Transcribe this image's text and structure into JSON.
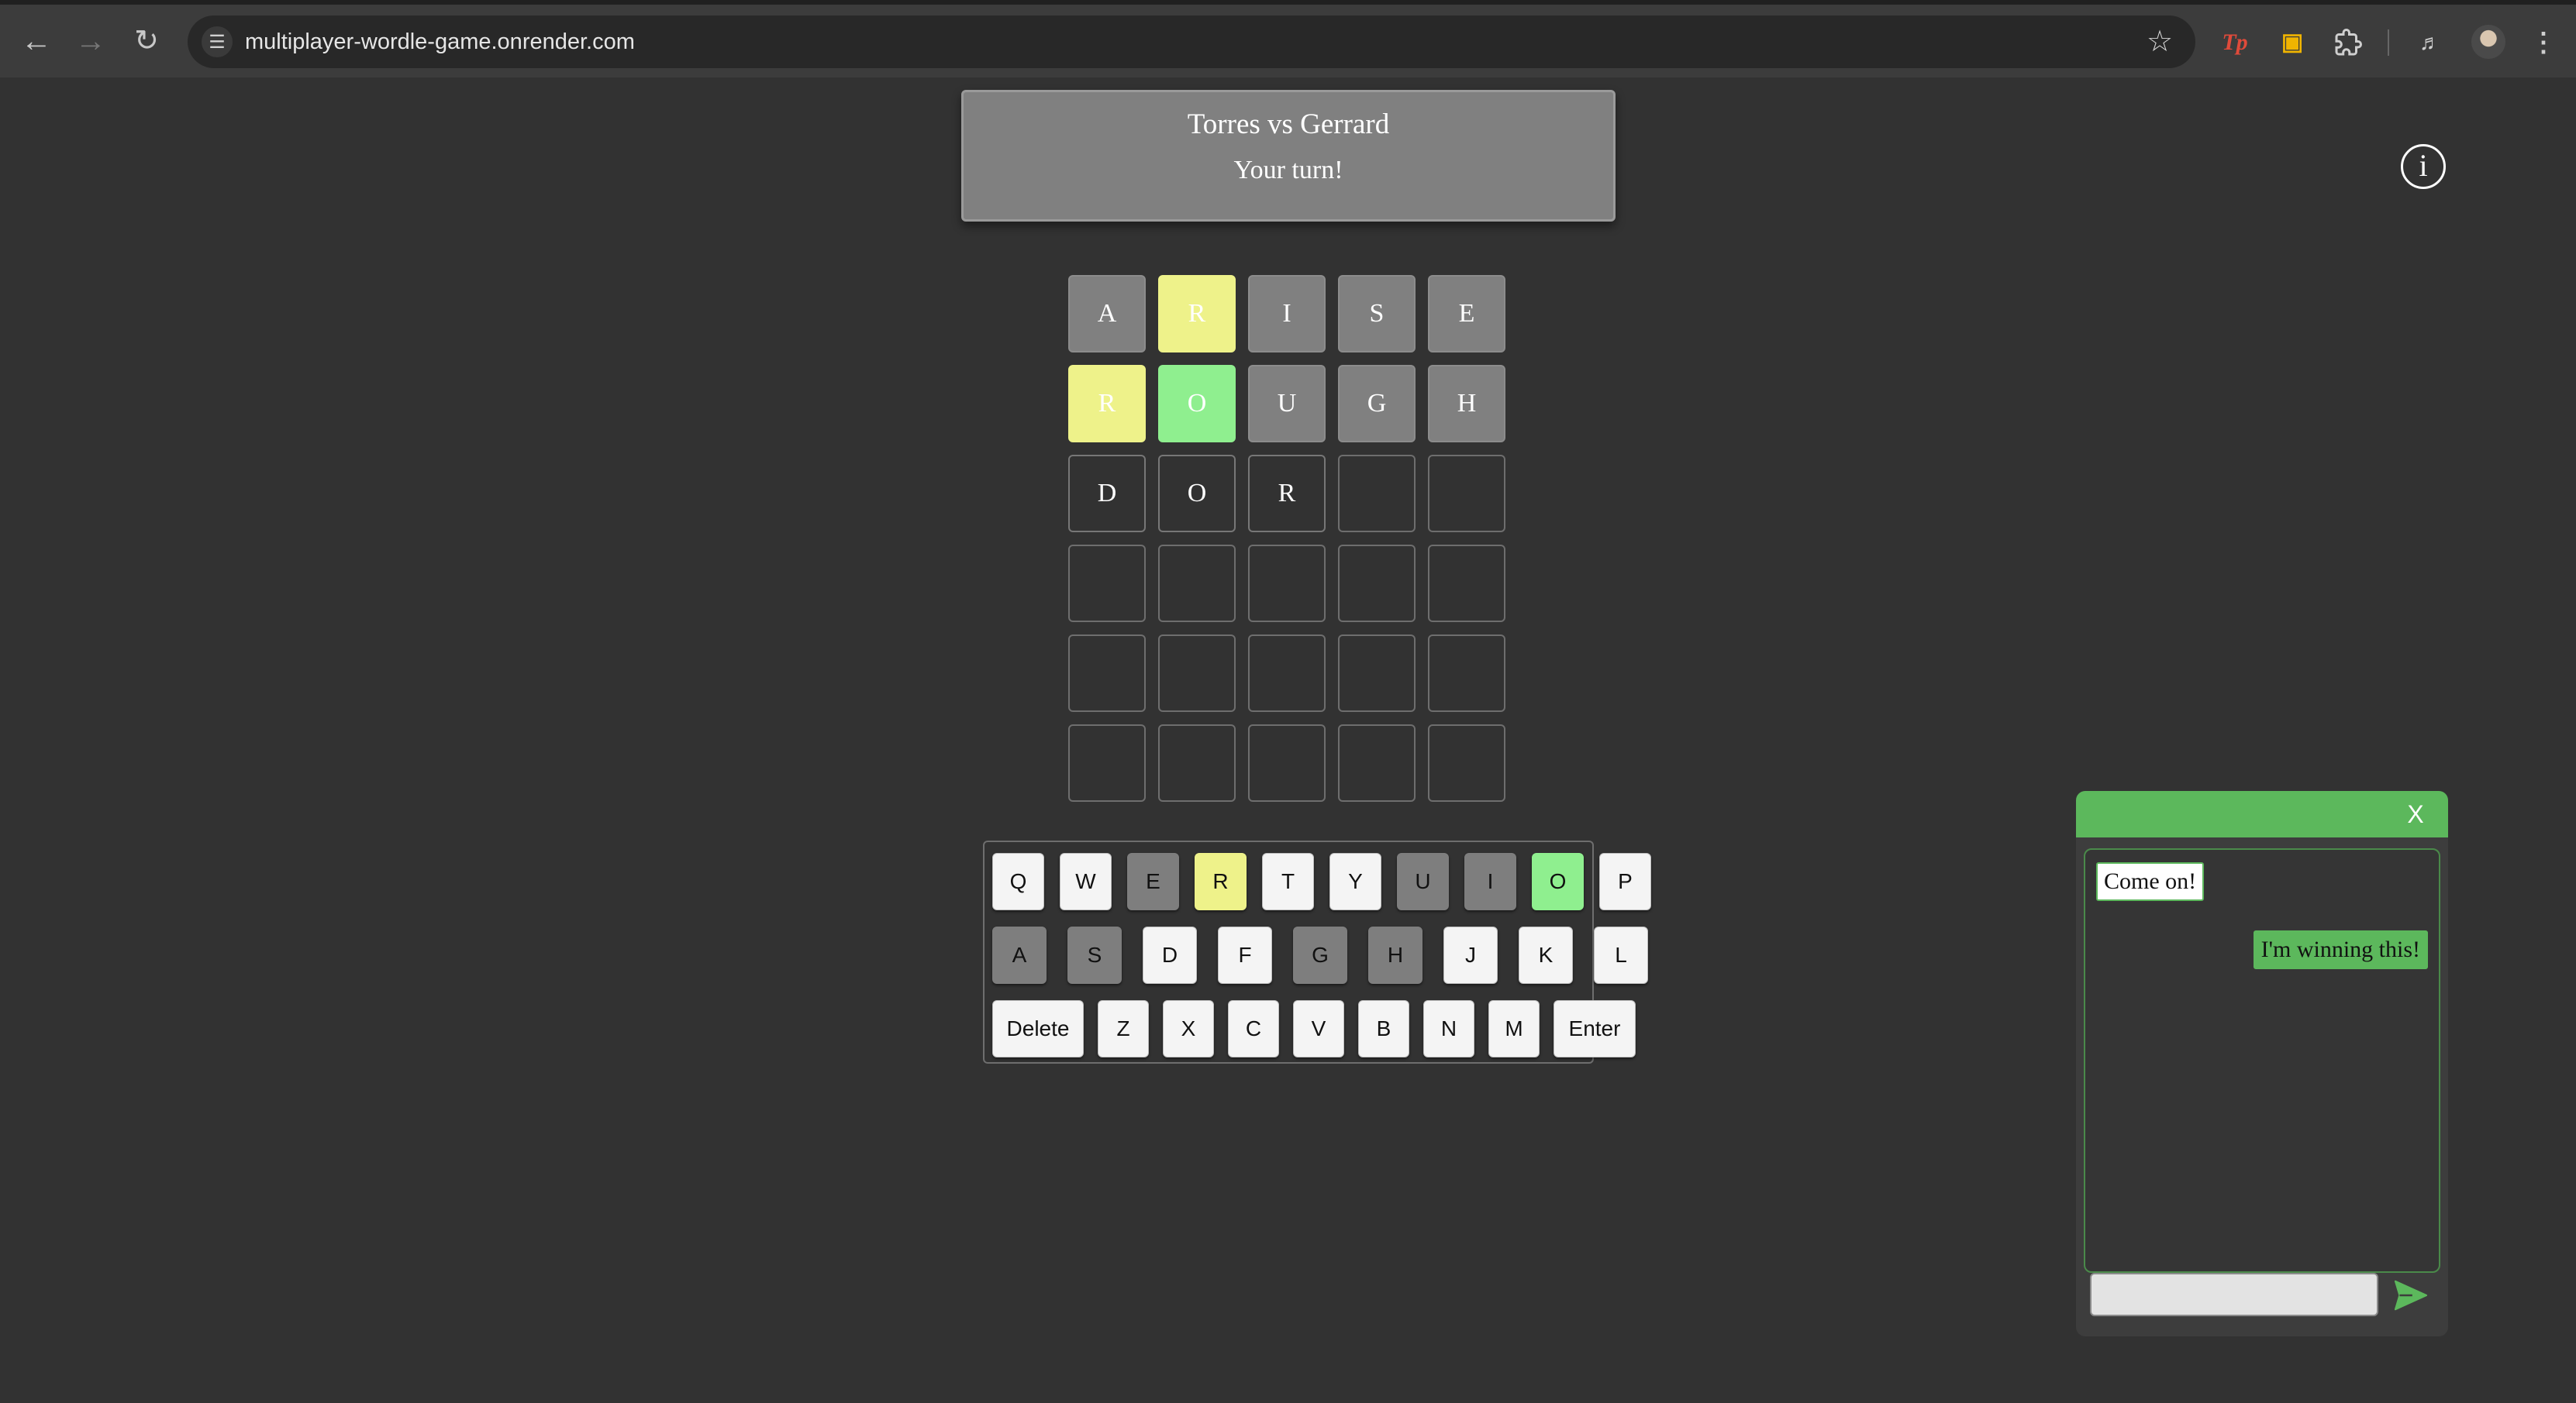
{
  "browser": {
    "url": "multiplayer-wordle-game.onrender.com",
    "icons": {
      "back": "back-arrow-icon",
      "forward": "forward-arrow-icon",
      "reload": "reload-icon",
      "site_settings": "tune-icon",
      "bookmark": "star-icon",
      "ext1": "tp-extension-icon",
      "ext2": "shopping-bag-extension-icon",
      "extensions": "puzzle-icon",
      "media": "media-control-icon",
      "profile": "avatar",
      "menu": "kebab-menu-icon"
    },
    "ext_tp_label": "Tp"
  },
  "header": {
    "matchup": "Torres vs Gerrard",
    "status": "Your turn!"
  },
  "info_button": {
    "label": "i",
    "icon": "info-icon"
  },
  "colors": {
    "absent": "#808080",
    "present": "#eef28a",
    "correct": "#8fef8f",
    "chat_accent": "#5cb85c",
    "background": "#323232"
  },
  "board": {
    "rows": [
      [
        {
          "letter": "A",
          "state": "absent"
        },
        {
          "letter": "R",
          "state": "present"
        },
        {
          "letter": "I",
          "state": "absent"
        },
        {
          "letter": "S",
          "state": "absent"
        },
        {
          "letter": "E",
          "state": "absent"
        }
      ],
      [
        {
          "letter": "R",
          "state": "present"
        },
        {
          "letter": "O",
          "state": "correct"
        },
        {
          "letter": "U",
          "state": "absent"
        },
        {
          "letter": "G",
          "state": "absent"
        },
        {
          "letter": "H",
          "state": "absent"
        }
      ],
      [
        {
          "letter": "D",
          "state": "typed"
        },
        {
          "letter": "O",
          "state": "typed"
        },
        {
          "letter": "R",
          "state": "typed"
        },
        {
          "letter": "",
          "state": "empty"
        },
        {
          "letter": "",
          "state": "empty"
        }
      ],
      [
        {
          "letter": "",
          "state": "empty"
        },
        {
          "letter": "",
          "state": "empty"
        },
        {
          "letter": "",
          "state": "empty"
        },
        {
          "letter": "",
          "state": "empty"
        },
        {
          "letter": "",
          "state": "empty"
        }
      ],
      [
        {
          "letter": "",
          "state": "empty"
        },
        {
          "letter": "",
          "state": "empty"
        },
        {
          "letter": "",
          "state": "empty"
        },
        {
          "letter": "",
          "state": "empty"
        },
        {
          "letter": "",
          "state": "empty"
        }
      ],
      [
        {
          "letter": "",
          "state": "empty"
        },
        {
          "letter": "",
          "state": "empty"
        },
        {
          "letter": "",
          "state": "empty"
        },
        {
          "letter": "",
          "state": "empty"
        },
        {
          "letter": "",
          "state": "empty"
        }
      ]
    ]
  },
  "keyboard": {
    "rows": [
      [
        {
          "label": "Q",
          "state": "unused"
        },
        {
          "label": "W",
          "state": "unused"
        },
        {
          "label": "E",
          "state": "absent"
        },
        {
          "label": "R",
          "state": "present"
        },
        {
          "label": "T",
          "state": "unused"
        },
        {
          "label": "Y",
          "state": "unused"
        },
        {
          "label": "U",
          "state": "absent"
        },
        {
          "label": "I",
          "state": "absent"
        },
        {
          "label": "O",
          "state": "correct"
        },
        {
          "label": "P",
          "state": "unused"
        }
      ],
      [
        {
          "label": "A",
          "state": "absent"
        },
        {
          "label": "S",
          "state": "absent"
        },
        {
          "label": "D",
          "state": "unused"
        },
        {
          "label": "F",
          "state": "unused"
        },
        {
          "label": "G",
          "state": "absent"
        },
        {
          "label": "H",
          "state": "absent"
        },
        {
          "label": "J",
          "state": "unused"
        },
        {
          "label": "K",
          "state": "unused"
        },
        {
          "label": "L",
          "state": "unused"
        }
      ],
      [
        {
          "label": "Delete",
          "state": "unused"
        },
        {
          "label": "Z",
          "state": "unused"
        },
        {
          "label": "X",
          "state": "unused"
        },
        {
          "label": "C",
          "state": "unused"
        },
        {
          "label": "V",
          "state": "unused"
        },
        {
          "label": "B",
          "state": "unused"
        },
        {
          "label": "N",
          "state": "unused"
        },
        {
          "label": "M",
          "state": "unused"
        },
        {
          "label": "Enter",
          "state": "unused"
        }
      ]
    ]
  },
  "chat": {
    "close_label": "X",
    "messages": [
      {
        "from": "opponent",
        "text": "Come on!"
      },
      {
        "from": "me",
        "text": "I'm winning this!"
      }
    ],
    "input_value": "",
    "input_placeholder": "",
    "send_icon": "send-icon"
  }
}
